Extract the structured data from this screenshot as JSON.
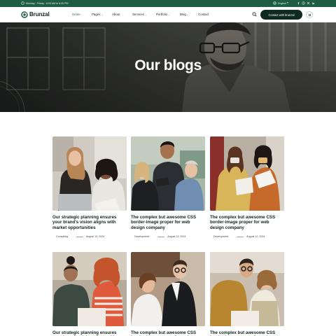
{
  "topbar": {
    "hours": "Monday - Friday : 8:00 AM to 6:00 PM",
    "language": "English",
    "social_icons": [
      "facebook-icon",
      "instagram-icon",
      "twitter-icon",
      "linkedin-icon"
    ]
  },
  "header": {
    "logo": "Brunzal",
    "nav": [
      {
        "label": "Home",
        "dropdown": true,
        "active": true
      },
      {
        "label": "Pages",
        "dropdown": true,
        "active": false
      },
      {
        "label": "About",
        "dropdown": false,
        "active": false
      },
      {
        "label": "Services",
        "dropdown": true,
        "active": false
      },
      {
        "label": "Portfolio",
        "dropdown": true,
        "active": false
      },
      {
        "label": "Blog",
        "dropdown": true,
        "active": false
      },
      {
        "label": "Contact",
        "dropdown": false,
        "active": false
      }
    ],
    "cta_label": "Contact with brunzal"
  },
  "hero": {
    "title": "Our blogs"
  },
  "posts": [
    {
      "title": "Our strategic planning ensures your brand's vision aligns with market opportunities",
      "category": "Consulting",
      "date": "August 13, 2024"
    },
    {
      "title": "The complex but awesome CSS border-image proper for web design company",
      "category": "Development",
      "date": "August 13, 2024"
    },
    {
      "title": "The complex but awesome CSS border-image proper for web design company",
      "category": "Development",
      "date": "August 12, 2024"
    },
    {
      "title": "Our strategic planning ensures your brand's vision aligns with market opportunities",
      "category": "",
      "date": ""
    },
    {
      "title": "The complex but awesome CSS border-image proper for web design company",
      "category": "",
      "date": ""
    },
    {
      "title": "The complex but awesome CSS border-image proper for web design company",
      "category": "",
      "date": ""
    }
  ],
  "colors": {
    "brand_green": "#1f5c45",
    "dark": "#0f2a20",
    "accent_green": "#1f6b4d"
  }
}
